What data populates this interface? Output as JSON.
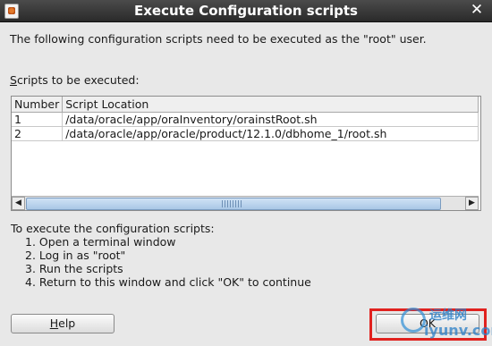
{
  "window": {
    "title": "Execute Configuration scripts",
    "close_glyph": "✕"
  },
  "message": "The following configuration scripts need to be executed as the \"root\" user.",
  "scripts_label": {
    "mnemonic": "S",
    "rest": "cripts to be executed:"
  },
  "table": {
    "headers": [
      "Number",
      "Script Location"
    ],
    "rows": [
      [
        "1",
        "/data/oracle/app/oraInventory/orainstRoot.sh"
      ],
      [
        "2",
        "/data/oracle/app/oracle/product/12.1.0/dbhome_1/root.sh"
      ]
    ]
  },
  "scrollbar": {
    "left_glyph": "◀",
    "right_glyph": "▶"
  },
  "instructions": {
    "heading": "To execute the configuration scripts:",
    "steps": [
      "1. Open a terminal window",
      "2. Log in as \"root\"",
      "3. Run the scripts",
      "4. Return to this window and click \"OK\" to continue"
    ]
  },
  "buttons": {
    "help": {
      "mnemonic": "H",
      "rest": "elp"
    },
    "ok": "OK"
  },
  "watermark": {
    "cn": "运维网",
    "en": "iyunv.com"
  },
  "colors": {
    "titlebar": "#2f2f2f",
    "highlight": "#e0211e",
    "scroll_thumb": "#a9c7e6"
  }
}
